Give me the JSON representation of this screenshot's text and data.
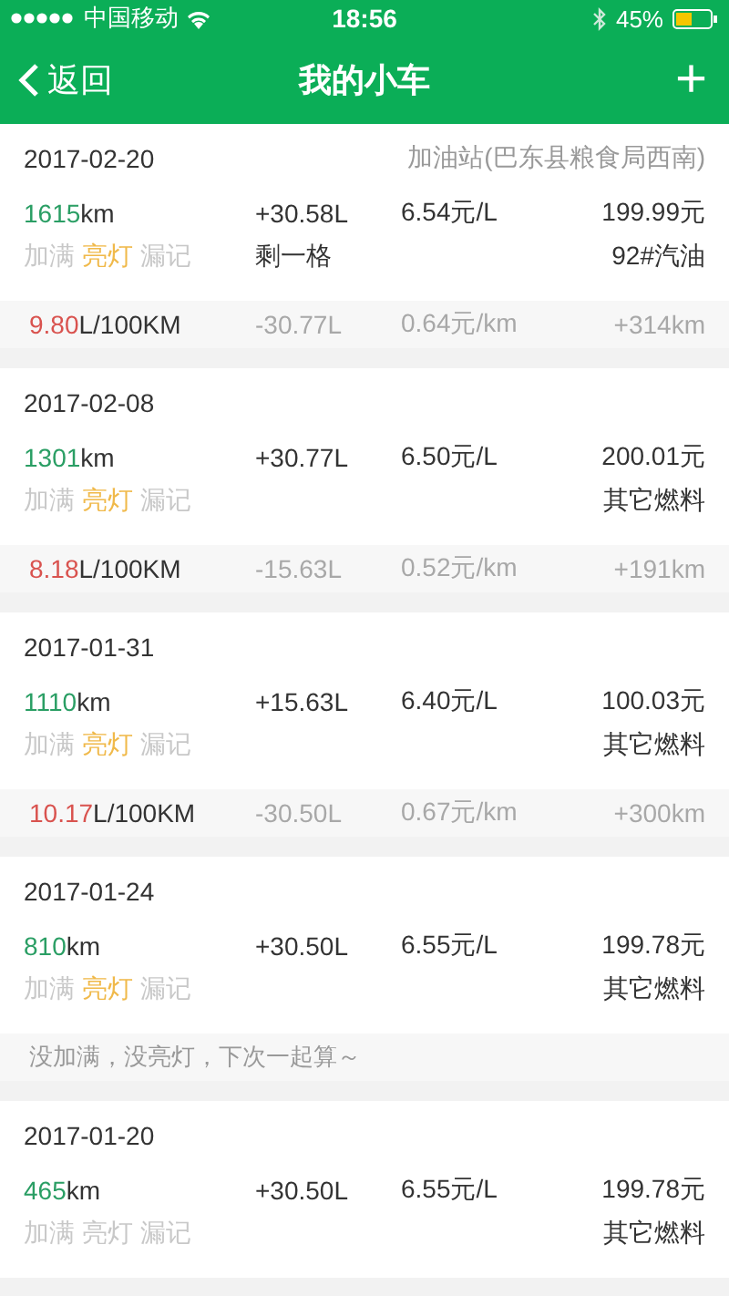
{
  "status_bar": {
    "carrier": "中国移动",
    "time": "18:56",
    "battery": "45%"
  },
  "nav": {
    "back": "返回",
    "title": "我的小车",
    "add": "+"
  },
  "entries": [
    {
      "date": "2017-02-20",
      "station": "加油站(巴东县粮食局西南)",
      "odometer": "1615",
      "odometer_unit": "km",
      "liters": "+30.58L",
      "price": "6.54元/L",
      "total": "199.99元",
      "tags": [
        {
          "label": "加满",
          "on": false
        },
        {
          "label": "亮灯",
          "on": true
        },
        {
          "label": "漏记",
          "on": false
        }
      ],
      "note": "剩一格",
      "fuel": "92#汽油",
      "footer": {
        "kind": "stats",
        "consumption": "9.80",
        "consumption_unit": "L/100KM",
        "liters_diff": "-30.77L",
        "cost_per_km": "0.64元/km",
        "distance": "+314km"
      }
    },
    {
      "date": "2017-02-08",
      "odometer": "1301",
      "odometer_unit": "km",
      "liters": "+30.77L",
      "price": "6.50元/L",
      "total": "200.01元",
      "tags": [
        {
          "label": "加满",
          "on": false
        },
        {
          "label": "亮灯",
          "on": true
        },
        {
          "label": "漏记",
          "on": false
        }
      ],
      "fuel": "其它燃料",
      "footer": {
        "kind": "stats",
        "consumption": "8.18",
        "consumption_unit": "L/100KM",
        "liters_diff": "-15.63L",
        "cost_per_km": "0.52元/km",
        "distance": "+191km"
      }
    },
    {
      "date": "2017-01-31",
      "odometer": "1110",
      "odometer_unit": "km",
      "liters": "+15.63L",
      "price": "6.40元/L",
      "total": "100.03元",
      "tags": [
        {
          "label": "加满",
          "on": false
        },
        {
          "label": "亮灯",
          "on": true
        },
        {
          "label": "漏记",
          "on": false
        }
      ],
      "fuel": "其它燃料",
      "footer": {
        "kind": "stats",
        "consumption": "10.17",
        "consumption_unit": "L/100KM",
        "liters_diff": "-30.50L",
        "cost_per_km": "0.67元/km",
        "distance": "+300km"
      }
    },
    {
      "date": "2017-01-24",
      "odometer": "810",
      "odometer_unit": "km",
      "liters": "+30.50L",
      "price": "6.55元/L",
      "total": "199.78元",
      "tags": [
        {
          "label": "加满",
          "on": false
        },
        {
          "label": "亮灯",
          "on": true
        },
        {
          "label": "漏记",
          "on": false
        }
      ],
      "fuel": "其它燃料",
      "footer": {
        "kind": "message",
        "text": "没加满，没亮灯，下次一起算～"
      }
    },
    {
      "date": "2017-01-20",
      "odometer": "465",
      "odometer_unit": "km",
      "liters": "+30.50L",
      "price": "6.55元/L",
      "total": "199.78元",
      "tags": [
        {
          "label": "加满",
          "on": false
        },
        {
          "label": "亮灯",
          "on": false
        },
        {
          "label": "漏记",
          "on": false
        }
      ],
      "fuel": "其它燃料"
    }
  ]
}
